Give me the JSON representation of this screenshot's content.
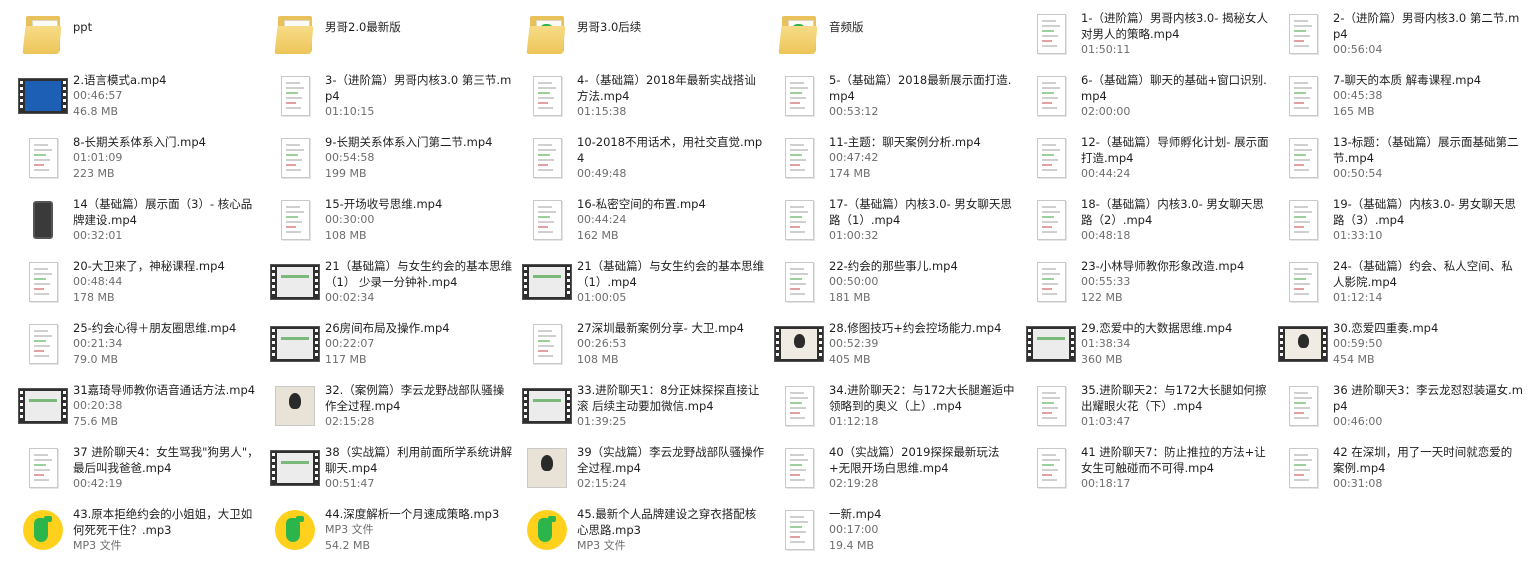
{
  "files": [
    {
      "name": "ppt",
      "meta": [],
      "icon": "folder-icon",
      "badge": false
    },
    {
      "name": "男哥2.0最新版",
      "meta": [],
      "icon": "folder-icon",
      "badge": false
    },
    {
      "name": "男哥3.0后续",
      "meta": [],
      "icon": "folder-icon",
      "badge": true
    },
    {
      "name": "音频版",
      "meta": [],
      "icon": "folder-icon",
      "badge": true
    },
    {
      "name": "1-（进阶篇）男哥内核3.0- 揭秘女人对男人的策略.mp4",
      "meta": [
        "01:50:11"
      ],
      "icon": "document-icon"
    },
    {
      "name": "2-（进阶篇）男哥内核3.0 第二节.mp4",
      "meta": [
        "00:56:04"
      ],
      "icon": "document-icon"
    },
    {
      "name": "2.语言模式a.mp4",
      "meta": [
        "00:46:57",
        "46.8 MB"
      ],
      "icon": "video-thumb-icon",
      "screen": "blue"
    },
    {
      "name": "3-（进阶篇）男哥内核3.0 第三节.mp4",
      "meta": [
        "01:10:15"
      ],
      "icon": "document-icon"
    },
    {
      "name": "4-（基础篇）2018年最新实战搭讪方法.mp4",
      "meta": [
        "01:15:38"
      ],
      "icon": "document-icon"
    },
    {
      "name": "5-（基础篇）2018最新展示面打造.mp4",
      "meta": [
        "00:53:12"
      ],
      "icon": "document-icon"
    },
    {
      "name": "6-（基础篇）聊天的基础+窗口识别.mp4",
      "meta": [
        "02:00:00"
      ],
      "icon": "document-icon"
    },
    {
      "name": "7-聊天的本质 解毒课程.mp4",
      "meta": [
        "00:45:38",
        "165 MB"
      ],
      "icon": "document-icon"
    },
    {
      "name": "8-长期关系体系入门.mp4",
      "meta": [
        "01:01:09",
        "223 MB"
      ],
      "icon": "document-icon"
    },
    {
      "name": "9-长期关系体系入门第二节.mp4",
      "meta": [
        "00:54:58",
        "199 MB"
      ],
      "icon": "document-icon"
    },
    {
      "name": "10-2018不用话术，用社交直觉.mp4",
      "meta": [
        "00:49:48"
      ],
      "icon": "document-icon"
    },
    {
      "name": "11-主题：聊天案例分析.mp4",
      "meta": [
        "00:47:42",
        "174 MB"
      ],
      "icon": "document-icon"
    },
    {
      "name": "12-（基础篇）导师孵化计划- 展示面打造.mp4",
      "meta": [
        "00:44:24"
      ],
      "icon": "document-icon"
    },
    {
      "name": "13-标题：（基础篇）展示面基础第二节.mp4",
      "meta": [
        "00:50:54"
      ],
      "icon": "document-icon"
    },
    {
      "name": "14（基础篇）展示面（3）- 核心品牌建设.mp4",
      "meta": [
        "00:32:01"
      ],
      "icon": "phone-thumb-icon"
    },
    {
      "name": "15-开场收号思维.mp4",
      "meta": [
        "00:30:00",
        "108 MB"
      ],
      "icon": "document-icon"
    },
    {
      "name": "16-私密空间的布置.mp4",
      "meta": [
        "00:44:24",
        "162 MB"
      ],
      "icon": "document-icon"
    },
    {
      "name": "17-（基础篇）内核3.0- 男女聊天思路（1）.mp4",
      "meta": [
        "01:00:32"
      ],
      "icon": "document-icon"
    },
    {
      "name": "18-（基础篇）内核3.0- 男女聊天思路（2）.mp4",
      "meta": [
        "00:48:18"
      ],
      "icon": "document-icon"
    },
    {
      "name": "19-（基础篇）内核3.0- 男女聊天思路（3）.mp4",
      "meta": [
        "01:33:10"
      ],
      "icon": "document-icon"
    },
    {
      "name": "20-大卫来了，神秘课程.mp4",
      "meta": [
        "00:48:44",
        "178 MB"
      ],
      "icon": "document-icon"
    },
    {
      "name": "21（基础篇）与女生约会的基本思维（1） 少录一分钟补.mp4",
      "meta": [
        "00:02:34"
      ],
      "icon": "video-thumb-icon",
      "screen": "light"
    },
    {
      "name": "21（基础篇）与女生约会的基本思维（1）.mp4",
      "meta": [
        "01:00:05"
      ],
      "icon": "video-thumb-icon",
      "screen": "light"
    },
    {
      "name": "22-约会的那些事儿.mp4",
      "meta": [
        "00:50:00",
        "181 MB"
      ],
      "icon": "document-icon"
    },
    {
      "name": "23-小林导师教你形象改造.mp4",
      "meta": [
        "00:55:33",
        "122 MB"
      ],
      "icon": "document-icon"
    },
    {
      "name": "24-（基础篇）约会、私人空间、私人影院.mp4",
      "meta": [
        "01:12:14"
      ],
      "icon": "document-icon"
    },
    {
      "name": "25-约会心得＋朋友圈思维.mp4",
      "meta": [
        "00:21:34",
        "79.0 MB"
      ],
      "icon": "document-icon"
    },
    {
      "name": "26房间布局及操作.mp4",
      "meta": [
        "00:22:07",
        "117 MB"
      ],
      "icon": "video-thumb-icon",
      "screen": "light"
    },
    {
      "name": "27深圳最新案例分享- 大卫.mp4",
      "meta": [
        "00:26:53",
        "108 MB"
      ],
      "icon": "document-icon"
    },
    {
      "name": "28.修图技巧+约会控场能力.mp4",
      "meta": [
        "00:52:39",
        "405 MB"
      ],
      "icon": "video-thumb-icon",
      "screen": "person"
    },
    {
      "name": "29.恋爱中的大数据思维.mp4",
      "meta": [
        "01:38:34",
        "360 MB"
      ],
      "icon": "video-thumb-icon",
      "screen": "light"
    },
    {
      "name": "30.恋爱四重奏.mp4",
      "meta": [
        "00:59:50",
        "454 MB"
      ],
      "icon": "video-thumb-icon",
      "screen": "person"
    },
    {
      "name": "31嘉琦导师教你语音通话方法.mp4",
      "meta": [
        "00:20:38",
        "75.6 MB"
      ],
      "icon": "video-thumb-icon",
      "screen": "light"
    },
    {
      "name": "32.（案例篇）李云龙野战部队骚操作全过程.mp4",
      "meta": [
        "02:15:28"
      ],
      "icon": "photo-thumb-icon"
    },
    {
      "name": "33.进阶聊天1：8分正妹探探直接让滚 后续主动要加微信.mp4",
      "meta": [
        "01:39:25"
      ],
      "icon": "video-thumb-icon",
      "screen": "light"
    },
    {
      "name": "34.进阶聊天2：与172大长腿邂逅中领略到的奥义（上）.mp4",
      "meta": [
        "01:12:18"
      ],
      "icon": "document-icon"
    },
    {
      "name": "35.进阶聊天2：与172大长腿如何擦出耀眼火花（下）.mp4",
      "meta": [
        "01:03:47"
      ],
      "icon": "document-icon"
    },
    {
      "name": "36 进阶聊天3：李云龙怼怼装逼女.mp4",
      "meta": [
        "00:46:00"
      ],
      "icon": "document-icon"
    },
    {
      "name": "37 进阶聊天4：女生骂我\"狗男人\"，最后叫我爸爸.mp4",
      "meta": [
        "00:42:19"
      ],
      "icon": "document-icon"
    },
    {
      "name": "38（实战篇）利用前面所学系统讲解聊天.mp4",
      "meta": [
        "00:51:47"
      ],
      "icon": "video-thumb-icon",
      "screen": "light"
    },
    {
      "name": "39（实战篇）李云龙野战部队骚操作全过程.mp4",
      "meta": [
        "02:15:24"
      ],
      "icon": "photo-thumb-icon"
    },
    {
      "name": "40（实战篇）2019探探最新玩法+无限开场白思维.mp4",
      "meta": [
        "02:19:28"
      ],
      "icon": "document-icon"
    },
    {
      "name": "41 进阶聊天7：防止推拉的方法+让女生可触碰而不可得.mp4",
      "meta": [
        "00:18:17"
      ],
      "icon": "document-icon"
    },
    {
      "name": "42 在深圳，用了一天时间就恋爱的案例.mp4",
      "meta": [
        "00:31:08"
      ],
      "icon": "document-icon"
    },
    {
      "name": "43.原本拒绝约会的小姐姐，大卫如何死死干住？.mp3",
      "meta": [
        "MP3 文件"
      ],
      "icon": "mp3-icon"
    },
    {
      "name": "44.深度解析一个月速成策略.mp3",
      "meta": [
        "MP3 文件",
        "54.2 MB"
      ],
      "icon": "mp3-icon"
    },
    {
      "name": "45.最新个人品牌建设之穿衣搭配核心思路.mp3",
      "meta": [
        "MP3 文件"
      ],
      "icon": "mp3-icon"
    },
    {
      "name": "一新.mp4",
      "meta": [
        "00:17:00",
        "19.4 MB"
      ],
      "icon": "document-icon"
    }
  ]
}
